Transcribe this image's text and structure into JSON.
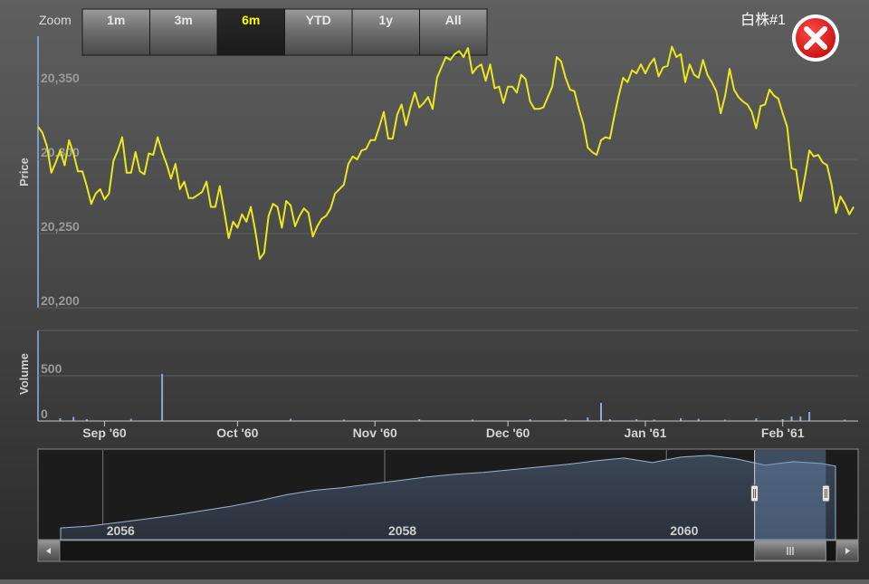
{
  "ui": {
    "zoom_label": "Zoom",
    "zoom_buttons": [
      "1m",
      "3m",
      "6m",
      "YTD",
      "1y",
      "All"
    ],
    "selected_zoom": "6m",
    "stock_label": "白株#1",
    "close_icon": "close-x-icon",
    "scrollbar_grip_icon": "grip-icon",
    "colors": {
      "line": "#e8e81e",
      "volume": "#8aa8d8",
      "selected_text": "#ffff00",
      "close": "#e01a1a"
    }
  },
  "chart_data": [
    {
      "type": "line",
      "name": "price",
      "ylabel": "Price",
      "ylim": [
        20200,
        20383
      ],
      "y_ticks": [
        "20,200",
        "20,250",
        "20,300",
        "20,350"
      ],
      "y_tick_values": [
        20200,
        20250,
        20300,
        20350
      ],
      "x_range": [
        "2060-08-17",
        "2061-02-18"
      ],
      "x_ticks": [
        "Sep '60",
        "Oct '60",
        "Nov '60",
        "Dec '60",
        "Jan '61",
        "Feb '61"
      ],
      "x_tick_dates": [
        "2060-09-01",
        "2060-10-01",
        "2060-11-01",
        "2060-12-01",
        "2061-01-01",
        "2061-02-01"
      ],
      "x": [
        "2060-08-17",
        "2060-08-18",
        "2060-08-19",
        "2060-08-20",
        "2060-08-21",
        "2060-08-22",
        "2060-08-23",
        "2060-08-24",
        "2060-08-25",
        "2060-08-26",
        "2060-08-27",
        "2060-08-28",
        "2060-08-29",
        "2060-08-30",
        "2060-08-31",
        "2060-09-01",
        "2060-09-02",
        "2060-09-03",
        "2060-09-04",
        "2060-09-05",
        "2060-09-06",
        "2060-09-07",
        "2060-09-08",
        "2060-09-09",
        "2060-09-10",
        "2060-09-11",
        "2060-09-12",
        "2060-09-13",
        "2060-09-14",
        "2060-09-15",
        "2060-09-16",
        "2060-09-17",
        "2060-09-18",
        "2060-09-19",
        "2060-09-20",
        "2060-09-21",
        "2060-09-22",
        "2060-09-23",
        "2060-09-24",
        "2060-09-25",
        "2060-09-26",
        "2060-09-27",
        "2060-09-28",
        "2060-09-29",
        "2060-09-30",
        "2060-10-01",
        "2060-10-02",
        "2060-10-03",
        "2060-10-04",
        "2060-10-05",
        "2060-10-06",
        "2060-10-07",
        "2060-10-08",
        "2060-10-09",
        "2060-10-10",
        "2060-10-11",
        "2060-10-12",
        "2060-10-13",
        "2060-10-14",
        "2060-10-15",
        "2060-10-16",
        "2060-10-17",
        "2060-10-18",
        "2060-10-19",
        "2060-10-20",
        "2060-10-21",
        "2060-10-22",
        "2060-10-23",
        "2060-10-24",
        "2060-10-25",
        "2060-10-26",
        "2060-10-27",
        "2060-10-28",
        "2060-10-29",
        "2060-10-30",
        "2060-10-31",
        "2060-11-01",
        "2060-11-02",
        "2060-11-03",
        "2060-11-04",
        "2060-11-05",
        "2060-11-06",
        "2060-11-07",
        "2060-11-08",
        "2060-11-09",
        "2060-11-10",
        "2060-11-11",
        "2060-11-12",
        "2060-11-13",
        "2060-11-14",
        "2060-11-15",
        "2060-11-16",
        "2060-11-17",
        "2060-11-18",
        "2060-11-19",
        "2060-11-20",
        "2060-11-21",
        "2060-11-22",
        "2060-11-23",
        "2060-11-24",
        "2060-11-25",
        "2060-11-26",
        "2060-11-27",
        "2060-11-28",
        "2060-11-29",
        "2060-11-30",
        "2060-12-01",
        "2060-12-02",
        "2060-12-03",
        "2060-12-04",
        "2060-12-05",
        "2060-12-06",
        "2060-12-07",
        "2060-12-08",
        "2060-12-09",
        "2060-12-10",
        "2060-12-11",
        "2060-12-12",
        "2060-12-13",
        "2060-12-14",
        "2060-12-15",
        "2060-12-16",
        "2060-12-17",
        "2060-12-18",
        "2060-12-19",
        "2060-12-20",
        "2060-12-21",
        "2060-12-22",
        "2060-12-23",
        "2060-12-24",
        "2060-12-25",
        "2060-12-26",
        "2060-12-27",
        "2060-12-28",
        "2060-12-29",
        "2060-12-30",
        "2060-12-31",
        "2061-01-01",
        "2061-01-02",
        "2061-01-03",
        "2061-01-04",
        "2061-01-05",
        "2061-01-06",
        "2061-01-07",
        "2061-01-08",
        "2061-01-09",
        "2061-01-10",
        "2061-01-11",
        "2061-01-12",
        "2061-01-13",
        "2061-01-14",
        "2061-01-15",
        "2061-01-16",
        "2061-01-17",
        "2061-01-18",
        "2061-01-19",
        "2061-01-20",
        "2061-01-21",
        "2061-01-22",
        "2061-01-23",
        "2061-01-24",
        "2061-01-25",
        "2061-01-26",
        "2061-01-27",
        "2061-01-28",
        "2061-01-29",
        "2061-01-30",
        "2061-01-31",
        "2061-02-01",
        "2061-02-02",
        "2061-02-03",
        "2061-02-04",
        "2061-02-05",
        "2061-02-06",
        "2061-02-07",
        "2061-02-08",
        "2061-02-09",
        "2061-02-10",
        "2061-02-11",
        "2061-02-12",
        "2061-02-13",
        "2061-02-14",
        "2061-02-15",
        "2061-02-16",
        "2061-02-17",
        "2061-02-18"
      ],
      "y": [
        20322,
        20318,
        20309,
        20291,
        20298,
        20306,
        20296,
        20313,
        20304,
        20292,
        20292,
        20282,
        20270,
        20277,
        20280,
        20273,
        20277,
        20299,
        20306,
        20315,
        20291,
        20291,
        20305,
        20292,
        20290,
        20304,
        20303,
        20315,
        20305,
        20297,
        20287,
        20297,
        20280,
        20285,
        20274,
        20274,
        20276,
        20278,
        20285,
        20268,
        20268,
        20282,
        20265,
        20247,
        20258,
        20254,
        20263,
        20258,
        20268,
        20252,
        20233,
        20237,
        20262,
        20270,
        20268,
        20254,
        20272,
        20269,
        20255,
        20262,
        20267,
        20264,
        20248,
        20255,
        20260,
        20262,
        20267,
        20277,
        20280,
        20283,
        20297,
        20302,
        20300,
        20306,
        20307,
        20313,
        20313,
        20322,
        20332,
        20314,
        20314,
        20330,
        20337,
        20323,
        20335,
        20345,
        20335,
        20338,
        20342,
        20334,
        20355,
        20362,
        20369,
        20367,
        20371,
        20373,
        20369,
        20375,
        20358,
        20362,
        20364,
        20353,
        20364,
        20348,
        20349,
        20338,
        20349,
        20349,
        20345,
        20357,
        20354,
        20339,
        20334,
        20334,
        20335,
        20342,
        20349,
        20369,
        20366,
        20355,
        20347,
        20346,
        20334,
        20324,
        20308,
        20305,
        20303,
        20313,
        20315,
        20314,
        20329,
        20343,
        20355,
        20352,
        20360,
        20358,
        20364,
        20358,
        20364,
        20368,
        20356,
        20362,
        20363,
        20376,
        20369,
        20371,
        20352,
        20364,
        20357,
        20355,
        20367,
        20357,
        20352,
        20346,
        20331,
        20343,
        20361,
        20347,
        20342,
        20339,
        20337,
        20332,
        20321,
        20336,
        20337,
        20347,
        20343,
        20341,
        20331,
        20322,
        20294,
        20293,
        20272,
        20288,
        20306,
        20302,
        20303,
        20298,
        20296,
        20283,
        20264,
        20275,
        20270,
        20263,
        20268
      ]
    },
    {
      "type": "bar",
      "name": "volume",
      "ylabel": "Volume",
      "ylim": [
        0,
        1000
      ],
      "y_ticks": [
        "0",
        "500"
      ],
      "y_tick_values": [
        0,
        500
      ],
      "x": [
        "2060-08-22",
        "2060-08-25",
        "2060-08-28",
        "2060-09-07",
        "2060-09-14",
        "2060-10-13",
        "2060-10-25",
        "2060-11-11",
        "2060-11-23",
        "2060-12-06",
        "2060-12-14",
        "2060-12-19",
        "2060-12-22",
        "2060-12-24",
        "2060-12-30",
        "2061-01-03",
        "2061-01-09",
        "2061-01-13",
        "2061-01-19",
        "2061-01-26",
        "2061-02-01",
        "2061-02-03",
        "2061-02-05",
        "2061-02-07",
        "2061-02-15"
      ],
      "values": [
        30,
        45,
        20,
        25,
        520,
        25,
        15,
        20,
        15,
        20,
        20,
        40,
        200,
        20,
        20,
        15,
        30,
        25,
        15,
        30,
        20,
        50,
        50,
        100,
        15
      ]
    },
    {
      "type": "area",
      "name": "navigator",
      "x_ticks": [
        "2056",
        "2058",
        "2060"
      ],
      "x_range": [
        2055.7,
        2061.2
      ],
      "selected_range": [
        "2060-08-17",
        "2061-02-18"
      ],
      "x": [
        2055.7,
        2055.9,
        2056.1,
        2056.3,
        2056.5,
        2056.7,
        2056.9,
        2057.1,
        2057.3,
        2057.5,
        2057.7,
        2057.9,
        2058.1,
        2058.3,
        2058.5,
        2058.7,
        2058.9,
        2059.1,
        2059.3,
        2059.5,
        2059.7,
        2059.9,
        2060.1,
        2060.3,
        2060.5,
        2060.7,
        2060.9,
        2061.1,
        2061.2
      ],
      "y": [
        0.13,
        0.15,
        0.19,
        0.23,
        0.27,
        0.32,
        0.37,
        0.43,
        0.5,
        0.55,
        0.58,
        0.62,
        0.66,
        0.7,
        0.73,
        0.75,
        0.78,
        0.81,
        0.84,
        0.88,
        0.91,
        0.86,
        0.92,
        0.94,
        0.9,
        0.83,
        0.87,
        0.85,
        0.82
      ]
    }
  ]
}
